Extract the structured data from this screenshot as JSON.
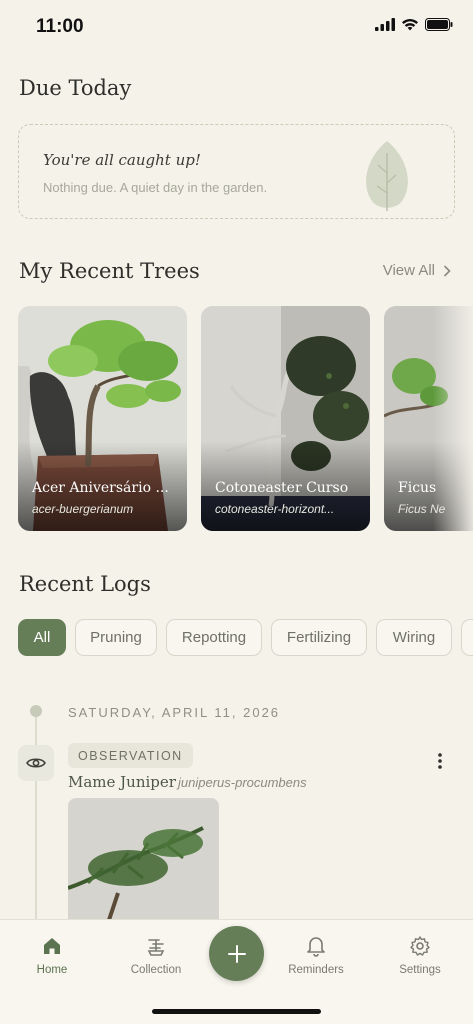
{
  "status": {
    "time": "11:00"
  },
  "due_today": {
    "title": "Due Today",
    "headline": "You're all caught up!",
    "message": "Nothing due. A quiet day in the garden."
  },
  "recent_trees": {
    "title": "My Recent Trees",
    "view_all": "View All",
    "items": [
      {
        "name": "Acer Aniversário ...",
        "species": "acer-buergerianum"
      },
      {
        "name": "Cotoneaster Curso",
        "species": "cotoneaster-horizont..."
      },
      {
        "name": "Ficus",
        "species": "Ficus Ne"
      }
    ]
  },
  "recent_logs": {
    "title": "Recent Logs",
    "filters": [
      "All",
      "Pruning",
      "Repotting",
      "Fertilizing",
      "Wiring"
    ],
    "active_filter": "All",
    "date": "SATURDAY, APRIL 11, 2026",
    "entry": {
      "type": "OBSERVATION",
      "tree_name": "Mame Juniper",
      "species": "juniperus-procumbens",
      "icon": "eye-icon"
    }
  },
  "tab_bar": {
    "home": "Home",
    "collection": "Collection",
    "reminders": "Reminders",
    "settings": "Settings"
  },
  "colors": {
    "accent": "#667e58",
    "background": "#f5f2ea"
  }
}
